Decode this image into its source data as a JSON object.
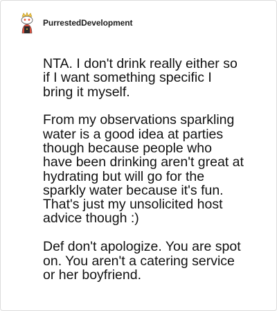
{
  "comment": {
    "author": "PurrestedDevelopment",
    "avatar_icon": "snoo-avatar-icon",
    "paragraphs": [
      "NTA. I don't drink really either so\nif I want something specific I\nbring it myself.",
      "From my observations sparkling\nwater is a good idea at parties\nthough because people who\nhave been drinking aren't great at\nhydrating but will go for the\nsparkly water because it's fun.\nThat's just my unsolicited host\nadvice though :)",
      "Def don't apologize. You are spot\non. You aren't a catering service\nor her boyfriend."
    ]
  }
}
